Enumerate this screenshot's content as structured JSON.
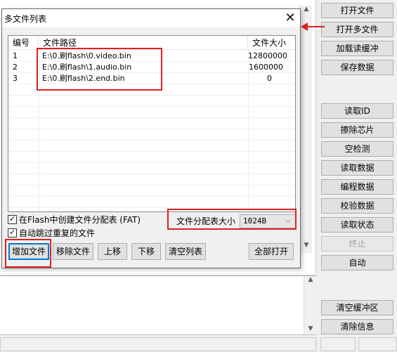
{
  "dialog": {
    "title": "多文件列表",
    "close_glyph": "✕",
    "table": {
      "headers": [
        "编号",
        "文件路径",
        "文件大小"
      ],
      "rows": [
        {
          "id": "1",
          "path": "E:\\0.刷flash\\0.video.bin",
          "size": "12800000"
        },
        {
          "id": "2",
          "path": "E:\\0.刷flash\\1.audio.bin",
          "size": "1600000"
        },
        {
          "id": "3",
          "path": "E:\\0.刷flash\\2.end.bin",
          "size": "0"
        }
      ]
    },
    "checkbox_fat": "在Flash中创建文件分配表 (FAT)",
    "checkbox_skip": "自动跳过重复的文件",
    "fat_size_label": "文件分配表大小",
    "fat_size_value": "1024B",
    "buttons": {
      "add": "增加文件",
      "remove": "移除文件",
      "up": "上移",
      "down": "下移",
      "clear": "清空列表",
      "open_all": "全部打开"
    }
  },
  "sidebar": {
    "open_file": "打开文件",
    "open_multi": "打开多文件",
    "load_buffer": "加载读缓冲",
    "save_data": "保存数据",
    "read_id": "读取ID",
    "erase_chip": "擦除芯片",
    "blank_check": "空检测",
    "read_data": "读取数据",
    "program_data": "编程数据",
    "verify_data": "校验数据",
    "read_status": "读取状态",
    "stop": "终止",
    "auto": "自动",
    "clear_buffer": "清空缓冲区",
    "clear_info": "清除信息"
  },
  "colors": {
    "highlight": "#e02020",
    "focus": "#0078d7"
  }
}
